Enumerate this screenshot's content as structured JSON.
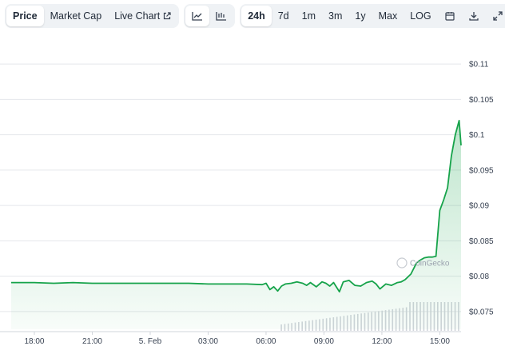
{
  "tabs": {
    "price": "Price",
    "market_cap": "Market Cap",
    "live_chart": "Live Chart"
  },
  "chart_types": [
    "line-chart-icon",
    "candlestick-icon"
  ],
  "ranges": [
    "24h",
    "7d",
    "1m",
    "3m",
    "1y",
    "Max",
    "LOG"
  ],
  "active_range": "24h",
  "tools": [
    "calendar-icon",
    "download-icon",
    "expand-icon"
  ],
  "watermark": "CoinGecko",
  "colors": {
    "line": "#16a34a",
    "accent_bg": "#eff2f5",
    "volume": "#d1d5db"
  },
  "chart_data": {
    "type": "area",
    "title": "",
    "xlabel": "",
    "ylabel": "",
    "y_ticks": [
      "$0.11",
      "$0.105",
      "$0.1",
      "$0.095",
      "$0.09",
      "$0.085",
      "$0.08",
      "$0.075"
    ],
    "y_tick_values": [
      0.11,
      0.105,
      0.1,
      0.095,
      0.09,
      0.085,
      0.08,
      0.075
    ],
    "ylim": [
      0.0725,
      0.1125
    ],
    "x_ticks": [
      "18:00",
      "21:00",
      "5. Feb",
      "03:00",
      "06:00",
      "09:00",
      "12:00",
      "15:00"
    ],
    "x_tick_hours": [
      0,
      3,
      6,
      9,
      12,
      15,
      18,
      21
    ],
    "xlim_hours": [
      -1.2,
      22.1
    ],
    "grid": true,
    "series": [
      {
        "x_hours": [
          -1.2,
          0,
          1,
          2,
          3,
          4,
          5,
          6,
          7,
          8,
          9,
          10,
          11,
          11.8,
          12.0,
          12.2,
          12.4,
          12.6,
          12.8,
          13.0,
          13.3,
          13.6,
          13.9,
          14.1,
          14.3,
          14.6,
          14.9,
          15.1,
          15.3,
          15.5,
          15.8,
          16.0,
          16.3,
          16.6,
          16.9,
          17.2,
          17.5,
          17.7,
          17.9,
          18.2,
          18.5,
          18.8,
          19.0,
          19.2,
          19.5,
          19.8,
          20.0,
          20.2,
          20.4,
          20.6,
          20.8,
          21.0,
          21.2,
          21.4,
          21.6,
          21.8,
          22.0,
          22.1
        ],
        "values": [
          0.0791,
          0.0791,
          0.079,
          0.0791,
          0.079,
          0.079,
          0.079,
          0.079,
          0.079,
          0.079,
          0.0789,
          0.0789,
          0.0789,
          0.0788,
          0.079,
          0.0781,
          0.0785,
          0.0779,
          0.0786,
          0.0789,
          0.079,
          0.0792,
          0.079,
          0.0787,
          0.0791,
          0.0785,
          0.0792,
          0.079,
          0.0786,
          0.0791,
          0.0778,
          0.0792,
          0.0794,
          0.0787,
          0.0786,
          0.0791,
          0.0793,
          0.0789,
          0.0782,
          0.0789,
          0.0787,
          0.0791,
          0.0792,
          0.0795,
          0.0803,
          0.0819,
          0.0823,
          0.0826,
          0.0827,
          0.0827,
          0.0828,
          0.0893,
          0.0908,
          0.0925,
          0.097,
          0.1,
          0.102,
          0.0985
        ]
      }
    ]
  }
}
